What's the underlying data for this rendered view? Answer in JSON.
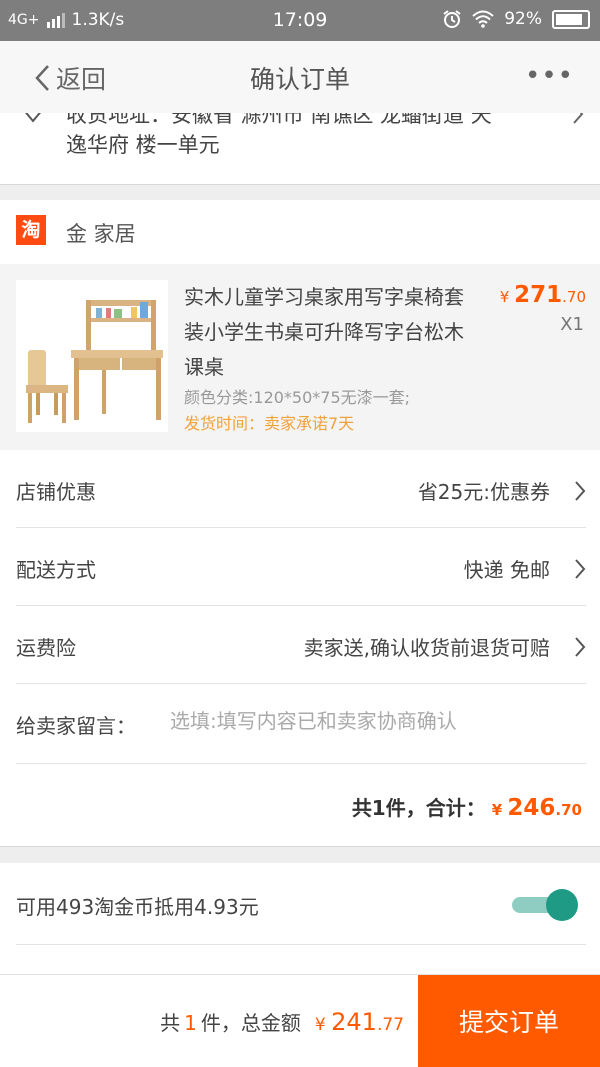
{
  "status_bar": {
    "network": "4G+",
    "speed": "1.3K/s",
    "time": "17:09",
    "battery": "92%"
  },
  "nav": {
    "back_label": "返回",
    "title": "确认订单",
    "more_label": "•••"
  },
  "address": {
    "line1": "收货地址：安徽省 滁州市 南谯区 龙蟠街道 天",
    "line2": "逸华府 楼一单元"
  },
  "shop": {
    "badge": "淘",
    "name": "金 家居"
  },
  "product": {
    "title": "实木儿童学习桌家用写字桌椅套装小学生书桌可升降写字台松木课桌",
    "variant": "颜色分类:120*50*75无漆一套;",
    "shipping": "发货时间：卖家承诺7天",
    "price_symbol": "¥",
    "price_int": "271",
    "price_dec": ".70",
    "quantity": "X1"
  },
  "rows": {
    "discount": {
      "label": "店铺优惠",
      "value": "省25元:优惠券"
    },
    "delivery": {
      "label": "配送方式",
      "value": "快递 免邮"
    },
    "insurance": {
      "label": "运费险",
      "value": "卖家送,确认收货前退货可赔"
    },
    "message": {
      "label": "给卖家留言：",
      "placeholder": "选填:填写内容已和卖家协商确认"
    }
  },
  "total": {
    "label": "共1件，合计：",
    "symbol": "¥",
    "int": "246",
    "dec": ".70"
  },
  "coins": {
    "label": "可用493淘金币抵用4.93元",
    "enabled": true
  },
  "bottom": {
    "prefix": "共",
    "count": "1",
    "suffix": "件，总金额",
    "symbol": "¥",
    "int": "241",
    "dec": ".77",
    "submit_label": "提交订单"
  },
  "colors": {
    "accent": "#ff5a00",
    "toggle": "#1e9a85",
    "shipping_text": "#f2a23a"
  }
}
